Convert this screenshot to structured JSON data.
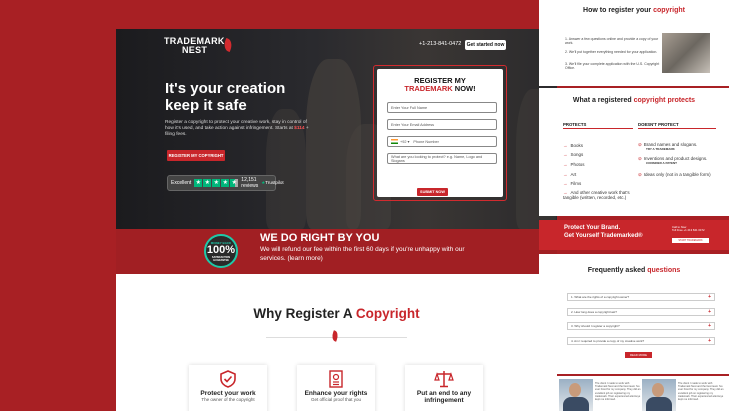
{
  "brand": {
    "line1": "TRADEMARK",
    "line2": "NEST",
    "accent": "#c8262b"
  },
  "header": {
    "phone": "+1-213-841-0472",
    "cta": "Get started now"
  },
  "hero": {
    "headline": "It's your creation keep it safe",
    "subtext": "Register a copyright to protect your creative work, stay in control of how it's used, and take action against infringement. Starts at ",
    "price": "$114",
    "price_suffix": " + filing fees.",
    "button": "REGISTER MY COPYRIGHT",
    "trust": {
      "label": "Excellent",
      "reviews": "12,151 reviews",
      "platform": "Trustpilot",
      "stars": 4.5
    }
  },
  "form": {
    "title_line1": "REGISTER MY",
    "title_red": "TRADEMARK",
    "title_end": " NOW!",
    "name_placeholder": "Enter Your Full Name",
    "email_placeholder": "Enter Your Email Address",
    "country_code": "+92",
    "phone_placeholder": "Phone Number",
    "protect_placeholder": "What are you looking to protect? e.g. Name, Logo and Slogans",
    "submit": "SUBMIT NOW"
  },
  "guarantee": {
    "badge_top": "MONEY BACK",
    "badge_num": "100%",
    "badge_bottom": "SATISFACTION GUARANTEE",
    "title": "WE DO RIGHT BY YOU",
    "text": "We will refund our fee within the first 60 days if you're unhappy with our services. (learn more)"
  },
  "why": {
    "title_plain": "Why Register A ",
    "title_red": "Copyright"
  },
  "cards": [
    {
      "icon": "shield-check-icon",
      "title": "Protect your work",
      "sub": "The owner of the copyright"
    },
    {
      "icon": "certificate-icon",
      "title": "Enhance your rights",
      "sub": "Get official proof that you"
    },
    {
      "icon": "scales-icon",
      "title": "Put an end to any infringement",
      "sub": ""
    }
  ],
  "right": {
    "how_plain": "How to register your ",
    "how_red": "copyright",
    "steps": [
      "1. Answer a few questions online and provide a copy of your work.",
      "2. We'll put together everything needed for your application.",
      "3. We'll file your complete application with the U.S. Copyright Office."
    ],
    "protects_plain": "What a registered ",
    "protects_red": "copyright protects",
    "col_protects": "PROTECTS",
    "col_not": "DOESN'T PROTECT",
    "protects_items": [
      "Books",
      "Songs",
      "Photos",
      "Art",
      "Films",
      "And other creative work that's tangible (written, recorded, etc.)"
    ],
    "not_items": [
      {
        "text": "Brand names and slogans.",
        "hint": "TRY A TRADEMARK"
      },
      {
        "text": "Inventions and product designs.",
        "hint": "CONSIDER A PATENT"
      },
      {
        "text": "Ideas only (not in a tangible form)",
        "hint": ""
      }
    ],
    "banner_line1": "Protect Your Brand.",
    "banner_line2": "Get Yourself Trademarked®",
    "banner_small1": "Call to Now",
    "banner_small2": "Toll Free +1 213 841 0472",
    "banner_btn": "START TRADEMARK REGISTRATION",
    "faq_plain": "Frequently asked ",
    "faq_red": "questions",
    "faqs": [
      "1. What are the rights of a copyright owner?",
      "2. How long does a copyright last?",
      "3. Why should I register a copyright?",
      "4. Am I required to provide a copy of my creative work?"
    ],
    "read_more": "READ MORE",
    "testimonial1": "The client I made to work with Trademark Nest and the best team I've ever hired for my company. They did an excellent job on registering my trademark. Their experienced attorneys kept me informed.",
    "testimonial2": "The client I made to work with Trademark Nest and the best team I've ever hired for my company. They did an excellent job on registering my trademark. Their experienced attorneys kept me informed."
  }
}
